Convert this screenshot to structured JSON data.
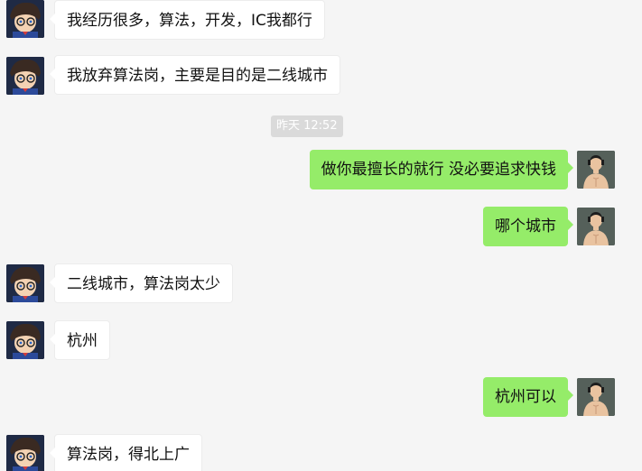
{
  "messages": [
    {
      "side": "in",
      "text": "我经历很多，算法，开发，IC我都行"
    },
    {
      "side": "in",
      "text": "我放弃算法岗，主要是目的是二线城市"
    },
    {
      "side": "out",
      "text": "做你最擅长的就行 没必要追求快钱"
    },
    {
      "side": "out",
      "text": "哪个城市"
    },
    {
      "side": "in",
      "text": "二线城市，算法岗太少"
    },
    {
      "side": "in",
      "text": "杭州"
    },
    {
      "side": "out",
      "text": "杭州可以"
    },
    {
      "side": "in",
      "text": "算法岗，得北上广"
    }
  ],
  "timestamp": "昨天 12:52",
  "colors": {
    "background": "#f5f5f5",
    "incoming_bubble": "#ffffff",
    "outgoing_bubble": "#95ec69",
    "timestamp_bg": "#dadada"
  },
  "icons": {
    "incoming_avatar": "conan-avatar-icon",
    "outgoing_avatar": "shirtless-man-avatar-icon"
  }
}
